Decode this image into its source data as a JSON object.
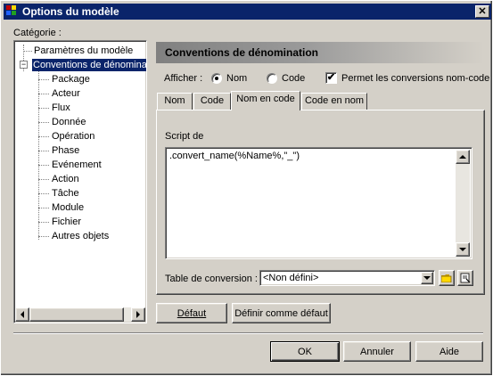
{
  "window": {
    "title": "Options du modèle",
    "close_glyph": "✕"
  },
  "category": {
    "label": "Catégorie :",
    "tree": [
      {
        "label": "Paramètres du modèle"
      },
      {
        "label": "Conventions de dénomination"
      },
      {
        "label": "Package"
      },
      {
        "label": "Acteur"
      },
      {
        "label": "Flux"
      },
      {
        "label": "Donnée"
      },
      {
        "label": "Opération"
      },
      {
        "label": "Phase"
      },
      {
        "label": "Evénement"
      },
      {
        "label": "Action"
      },
      {
        "label": "Tâche"
      },
      {
        "label": "Module"
      },
      {
        "label": "Fichier"
      },
      {
        "label": "Autres objets"
      }
    ],
    "expander_glyph": "−"
  },
  "panel": {
    "header": "Conventions de dénomination",
    "display_label": "Afficher :",
    "radio_name": "Nom",
    "radio_code": "Code",
    "radio_selected": "Nom",
    "allow_conversion_label": "Permet les conversions nom-code",
    "allow_conversion_checked": true,
    "check_glyph": "✔",
    "tabs": [
      {
        "label": "Nom"
      },
      {
        "label": "Code"
      },
      {
        "label": "Nom en code"
      },
      {
        "label": "Code en nom"
      }
    ],
    "active_tab": "Nom en code",
    "script_label": "Script de",
    "script_value": ".convert_name(%Name%,\"_\")",
    "conversion_table_label": "Table de conversion :",
    "conversion_table_value": "<Non défini>"
  },
  "buttons": {
    "default": "Défaut",
    "set_default": "Définir comme défaut",
    "ok": "OK",
    "cancel": "Annuler",
    "help": "Aide"
  },
  "colors": {
    "titlebar": "#0a246a",
    "face": "#d4d0c8",
    "selection": "#0a246a"
  }
}
